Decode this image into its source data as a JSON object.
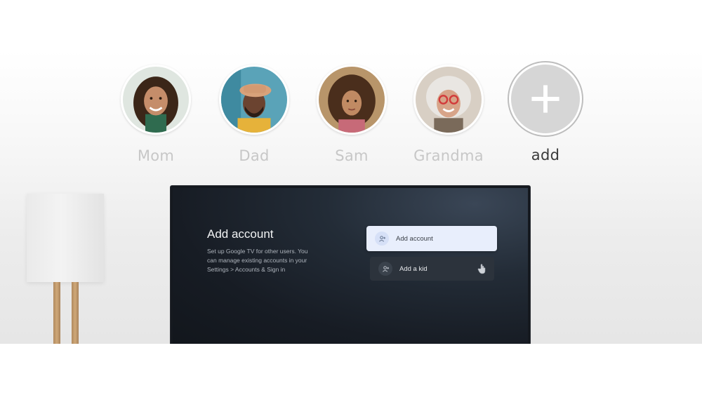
{
  "profiles": [
    {
      "name": "Mom",
      "avatar_icon": "woman-photo-icon"
    },
    {
      "name": "Dad",
      "avatar_icon": "man-photo-icon"
    },
    {
      "name": "Sam",
      "avatar_icon": "child-photo-icon"
    },
    {
      "name": "Grandma",
      "avatar_icon": "grandma-photo-icon"
    },
    {
      "name": "add",
      "avatar_icon": "plus-icon"
    }
  ],
  "tv": {
    "title": "Add account",
    "description": "Set up Google TV for other users. You can manage existing accounts in your Settings > Accounts & Sign in",
    "options": [
      {
        "label": "Add account",
        "icon": "add-person-icon",
        "selected": true
      },
      {
        "label": "Add a kid",
        "icon": "add-person-icon",
        "selected": false
      }
    ]
  },
  "colors": {
    "inactive_name": "#c7c7c7",
    "active_name": "#3b3b3b",
    "selected_option_bg": "#e8eefc",
    "tv_bg": "#171c24"
  }
}
